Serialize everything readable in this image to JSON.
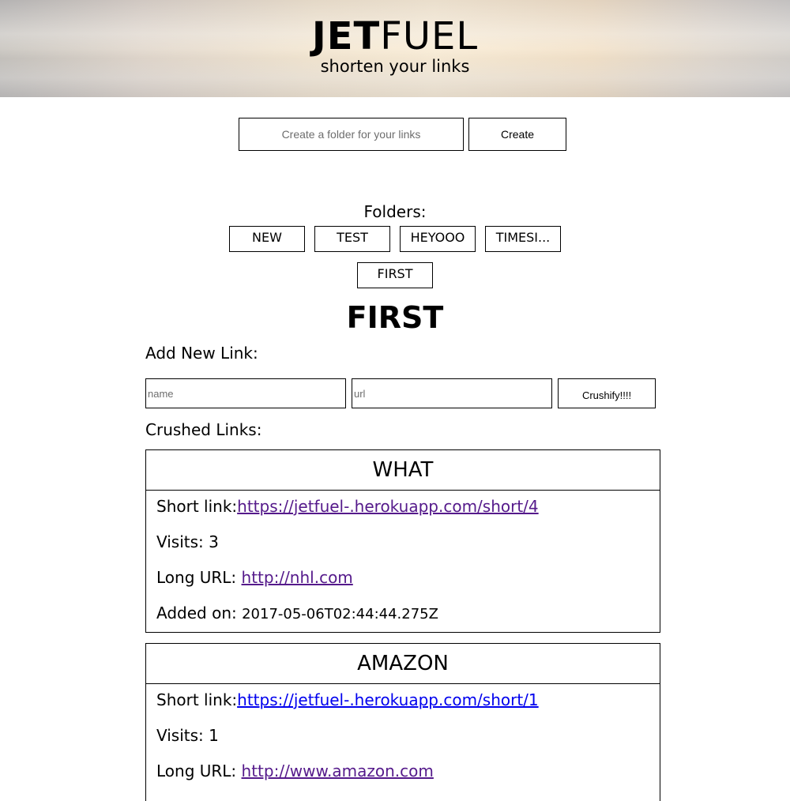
{
  "header": {
    "logo_bold": "JET",
    "logo_light": "FUEL",
    "tagline": "shorten your links"
  },
  "folder_form": {
    "placeholder": "Create a folder for your links",
    "create_label": "Create"
  },
  "folders": {
    "label": "Folders:",
    "items": [
      "NEW",
      "TEST",
      "HEYOOO",
      "TIMESI...",
      "FIRST"
    ]
  },
  "current_folder": "FIRST",
  "add_link": {
    "label": "Add New Link:",
    "name_placeholder": "name",
    "url_placeholder": "url",
    "submit_label": "Crushify!!!!"
  },
  "crushed_links": {
    "label": "Crushed Links:",
    "items": [
      {
        "title": "WHAT",
        "short_label": "Short link:",
        "short_url": "https://jetfuel-.herokuapp.com/short/4",
        "visits_label": "Visits: ",
        "visits": "3",
        "long_label": "Long URL: ",
        "long_url": "http://nhl.com",
        "added_label": "Added on: ",
        "added_on": "2017-05-06T02:44:44.275Z"
      },
      {
        "title": "AMAZON",
        "short_label": "Short link:",
        "short_url": "https://jetfuel-.herokuapp.com/short/1",
        "visits_label": "Visits: ",
        "visits": "1",
        "long_label": "Long URL: ",
        "long_url": "http://www.amazon.com"
      }
    ]
  },
  "colors": {
    "visited_link": "#551a8b",
    "unvisited_link": "#0000ee"
  }
}
